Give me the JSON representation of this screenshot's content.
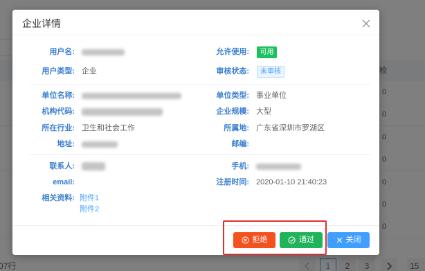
{
  "modal": {
    "title": "企业详情",
    "account": {
      "username_label": "用户名:",
      "allow_label": "允许使用:",
      "allow_tag": "可用",
      "user_type_label": "用户类型:",
      "user_type_value": "企业",
      "audit_label": "审核状态:",
      "audit_tag": "未审核"
    },
    "unit": {
      "name_label": "单位名称:",
      "type_label": "单位类型:",
      "type_value": "事业单位",
      "code_label": "机构代码:",
      "scale_label": "企业规模:",
      "scale_value": "大型",
      "industry_label": "所在行业:",
      "industry_value": "卫生和社会工作",
      "region_label": "所属地:",
      "region_value": "广东省深圳市罗湖区",
      "address_label": "地址:",
      "zip_label": "邮编:"
    },
    "contact": {
      "person_label": "联系人:",
      "phone_label": "手机:",
      "email_label": "email:",
      "reg_time_label": "注册时间:",
      "reg_time_value": "2020-01-10 21:40:23",
      "attachments_label": "相关资料:",
      "attachments": [
        "附件1",
        "附件2"
      ]
    },
    "footer": {
      "reject_label": "拒绝",
      "reject_icon": "circle-close-icon",
      "approve_label": "通过",
      "approve_icon": "circle-check-icon",
      "close_label": "关闭",
      "close_icon": "close-icon"
    }
  },
  "background": {
    "table": {
      "column_header": "检",
      "values": [
        "0",
        "0",
        "0",
        "0",
        "0",
        "0",
        "0"
      ]
    },
    "pagination": {
      "total_text": "07行",
      "pages": [
        "1",
        "2",
        "3"
      ],
      "current": "1",
      "page_size": "15"
    }
  },
  "colors": {
    "label": "#3b7fd0",
    "tag_ok": "#1ec15f",
    "reject": "#f4511e",
    "approve": "#21b35a",
    "close": "#409eff",
    "highlight": "#e02f2f"
  }
}
